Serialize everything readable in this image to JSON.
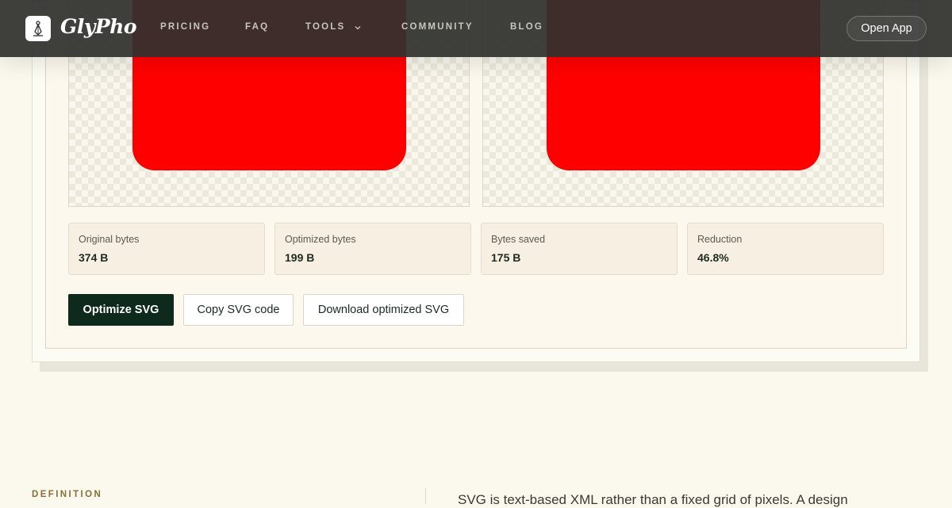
{
  "header": {
    "brand": "GlyPho",
    "nav": {
      "pricing": "PRICING",
      "faq": "FAQ",
      "tools": "TOOLS",
      "community": "COMMUNITY",
      "blog": "BLOG"
    },
    "open_app": "Open App"
  },
  "stats": {
    "original": {
      "label": "Original bytes",
      "value": "374 B"
    },
    "optimized": {
      "label": "Optimized bytes",
      "value": "199 B"
    },
    "saved": {
      "label": "Bytes saved",
      "value": "175 B"
    },
    "reduction": {
      "label": "Reduction",
      "value": "46.8%"
    }
  },
  "actions": {
    "optimize": "Optimize SVG",
    "copy": "Copy SVG code",
    "download": "Download optimized SVG"
  },
  "definition": {
    "label": "DEFINITION",
    "text": "SVG is text-based XML rather than a fixed grid of pixels. A design"
  },
  "colors": {
    "header_bg": "#30302e",
    "primary_button": "#0d2a1c",
    "shape_fill": "#ff0000",
    "page_bg": "#fbf8ee",
    "accent_label": "#8a6f35"
  },
  "icons": {
    "logo": "feather-pen-icon",
    "tools_dropdown": "chevron-down-icon"
  }
}
